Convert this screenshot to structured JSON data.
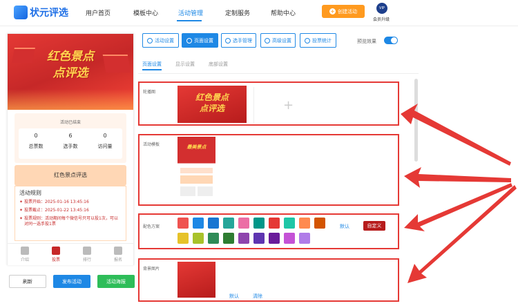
{
  "header": {
    "logo": "状元评选",
    "nav": [
      "用户首页",
      "模板中心",
      "活动管理",
      "定制服务",
      "帮助中心"
    ],
    "create_label": "创建活动",
    "vip_badge": "VIP",
    "vip_label": "会员升级"
  },
  "preview": {
    "banner_title_1": "红色景点",
    "banner_title_2": "点评选",
    "status": "活动已结束",
    "stats": [
      {
        "value": "0",
        "label": "总票数"
      },
      {
        "value": "6",
        "label": "选手数"
      },
      {
        "value": "0",
        "label": "访问量"
      }
    ],
    "activity_name": "红色景点评选",
    "rules_title": "活动规则",
    "rules": [
      "投票开始：2025-01-16 13:45:16",
      "投票截止：2025-01-22 13:45:16",
      "投票规则：活动期间每个微信号只可以投1次，可以对同一选手投1票"
    ],
    "tabs": [
      "介绍",
      "投票",
      "排行",
      "报名"
    ],
    "active_tab": "投票"
  },
  "bottom_buttons": [
    "刷新",
    "发布活动",
    "活动海报"
  ],
  "toolbar": {
    "tabs": [
      "活动设置",
      "页面设置",
      "选手管理",
      "高级设置",
      "投票统计"
    ],
    "active": "页面设置",
    "preview_label": "预览效果",
    "preview_on": true
  },
  "subtabs": [
    "页面设置",
    "显示设置",
    "底部设置"
  ],
  "sections": {
    "carousel": {
      "label": "轮播图",
      "thumb_title_1": "红色景点",
      "thumb_title_2": "点评选"
    },
    "template": {
      "label": "活动模板",
      "thumb_title": "最美景点"
    },
    "colors": {
      "label": "配色方案",
      "row1": [
        "#ef5350",
        "#1e88e5",
        "#1976d2",
        "#26a69a",
        "#ec6ea5",
        "#009688",
        "#e53935",
        "#1ec6a6",
        "#ff8a50",
        "#d35400"
      ],
      "row2": [
        "#e6c229",
        "#a8c22a",
        "#2e8b57",
        "#2e7d32",
        "#8e44ad",
        "#5e35b1",
        "#6a1b9a",
        "#c452d6",
        "#b07ce8"
      ],
      "default_label": "默认",
      "custom_label": "自定义"
    },
    "background": {
      "label": "背景图片",
      "default_label": "默认",
      "clear_label": "清除"
    }
  },
  "colors": {
    "accent": "#1e88e5",
    "brand_red": "#c62828",
    "highlight": "#e53935"
  }
}
